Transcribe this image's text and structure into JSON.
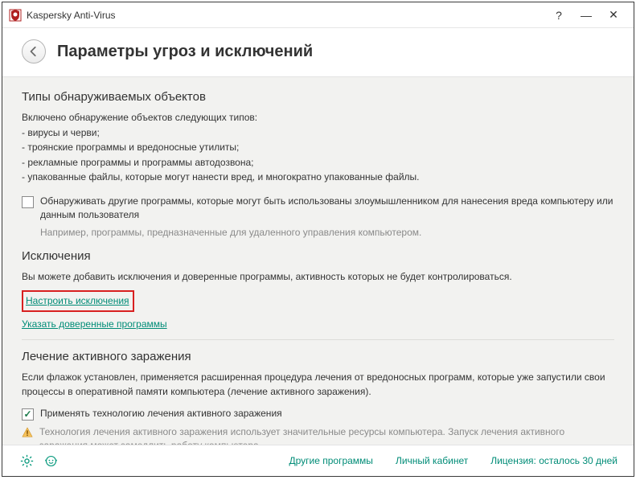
{
  "titlebar": {
    "title": "Kaspersky Anti-Virus"
  },
  "header": {
    "page_title": "Параметры угроз и исключений"
  },
  "threats": {
    "title": "Типы обнаруживаемых объектов",
    "intro": "Включено обнаружение объектов следующих типов:",
    "items": {
      "a": "- вирусы и черви;",
      "b": "- троянские программы и вредоносные утилиты;",
      "c": "- рекламные программы и программы автодозвона;",
      "d": "- упакованные файлы, которые могут нанести вред, и многократно упакованные файлы."
    },
    "detect_other_label": "Обнаруживать другие программы, которые могут быть использованы злоумышленником для нанесения вреда компьютеру или данным пользователя",
    "detect_other_hint": "Например, программы, предназначенные для удаленного управления компьютером."
  },
  "exclusions": {
    "title": "Исключения",
    "desc": "Вы можете добавить исключения и доверенные программы, активность которых не будет контролироваться.",
    "configure_link": "Настроить исключения",
    "trusted_link": "Указать доверенные программы"
  },
  "cure": {
    "title": "Лечение активного заражения",
    "desc": "Если флажок установлен, применяется расширенная процедура лечения от вредоносных программ, которые уже запустили свои процессы в оперативной памяти компьютера (лечение активного заражения).",
    "checkbox_label": "Применять технологию лечения активного заражения",
    "warning": "Технология лечения активного заражения использует значительные ресурсы компьютера. Запуск лечения активного заражения может замедлить работу компьютера."
  },
  "footer": {
    "other_programs": "Другие программы",
    "account": "Личный кабинет",
    "license": "Лицензия: осталось 30 дней"
  }
}
